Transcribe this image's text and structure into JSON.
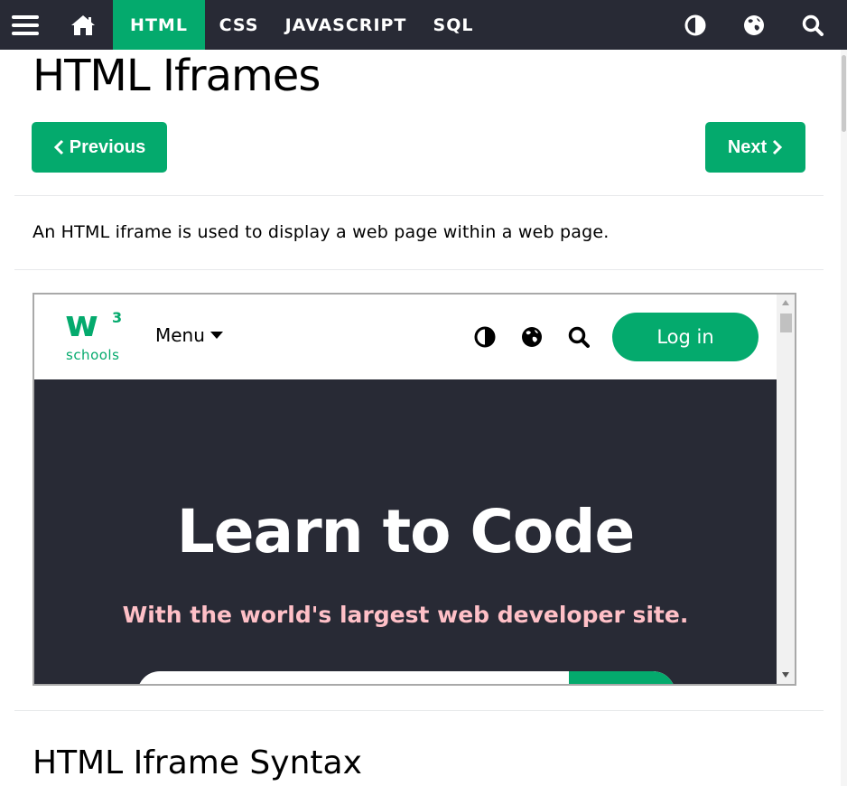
{
  "topnav": {
    "menu_icon": "hamburger-menu-icon",
    "home_icon": "home-icon",
    "links": [
      {
        "label": "HTML",
        "active": true
      },
      {
        "label": "CSS",
        "active": false
      },
      {
        "label": "JAVASCRIPT",
        "active": false
      },
      {
        "label": "SQL",
        "active": false
      }
    ],
    "right_icons": [
      "contrast-icon",
      "globe-icon",
      "search-icon"
    ]
  },
  "page": {
    "title": "HTML Iframes",
    "previous_label": "Previous",
    "next_label": "Next",
    "intro": "An HTML iframe is used to display a web page within a web page.",
    "section_heading": "HTML Iframe Syntax"
  },
  "iframe": {
    "logo_mark": "w",
    "logo_superscript": "3",
    "logo_text": "schools",
    "menu_label": "Menu",
    "login_label": "Log in",
    "hero_title": "Learn to Code",
    "hero_subtitle": "With the world's largest web developer site."
  },
  "colors": {
    "brand_green": "#04AA6D",
    "nav_dark": "#282A35",
    "hero_subtitle": "#FFC0C7"
  }
}
